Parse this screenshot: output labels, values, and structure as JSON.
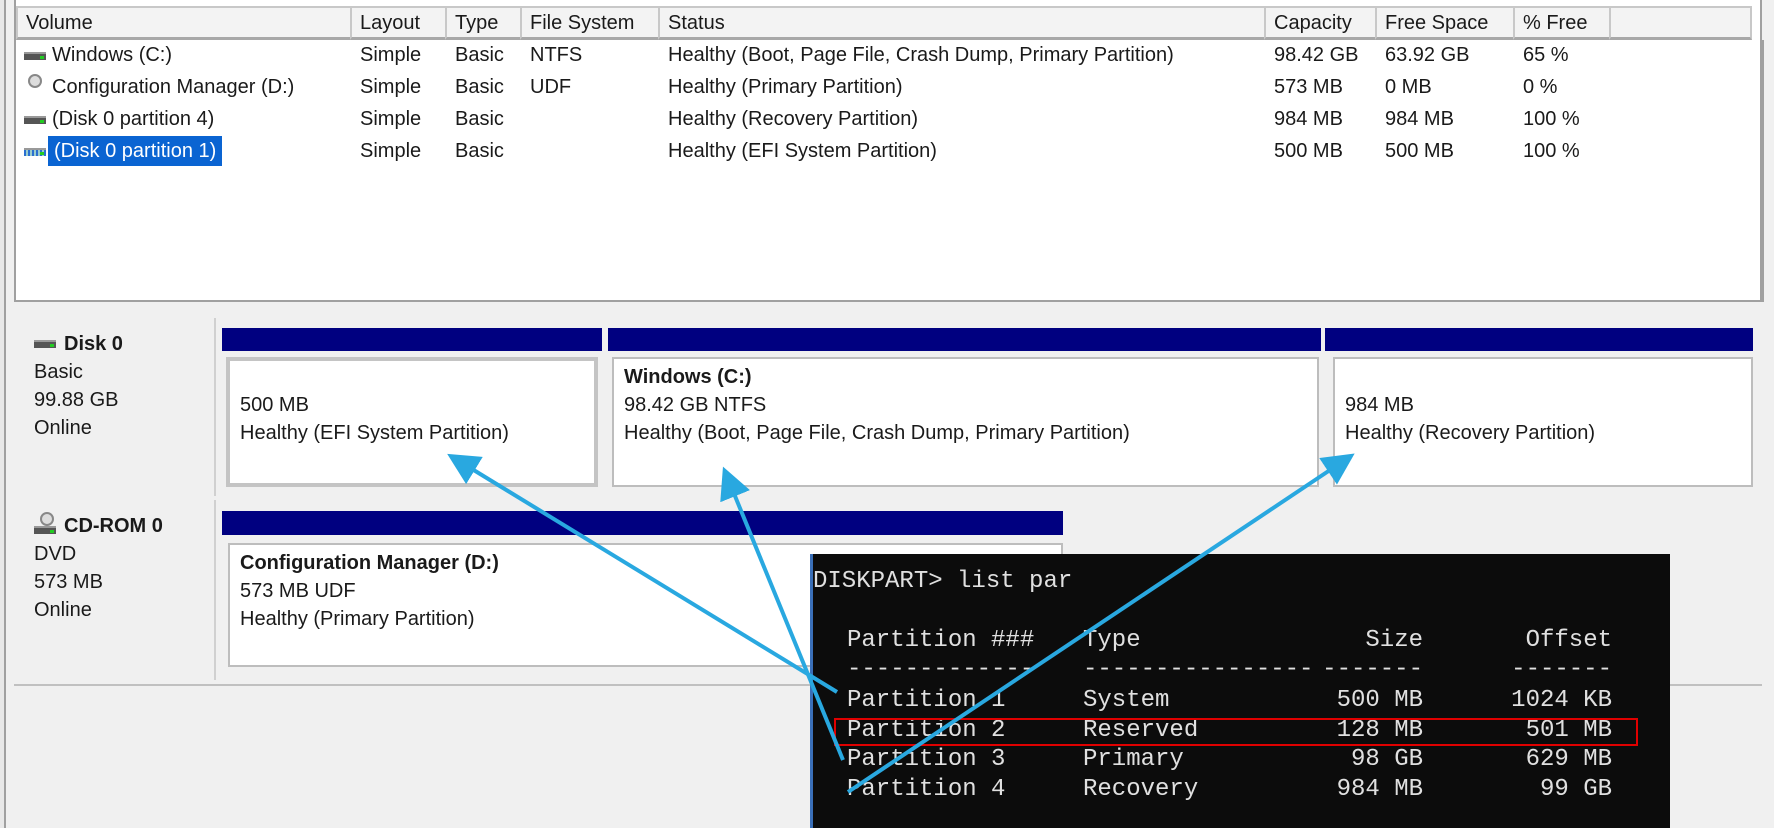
{
  "volume_list": {
    "columns": [
      "Volume",
      "Layout",
      "Type",
      "File System",
      "Status",
      "Capacity",
      "Free Space",
      "% Free"
    ],
    "rows": [
      {
        "icon": "hard-drive-icon",
        "volume": "Windows (C:)",
        "layout": "Simple",
        "type": "Basic",
        "fs": "NTFS",
        "status": "Healthy (Boot, Page File, Crash Dump, Primary Partition)",
        "capacity": "98.42 GB",
        "free": "63.92 GB",
        "pct": "65 %"
      },
      {
        "icon": "cd-drive-icon",
        "volume": "Configuration Manager (D:)",
        "layout": "Simple",
        "type": "Basic",
        "fs": "UDF",
        "status": "Healthy (Primary Partition)",
        "capacity": "573 MB",
        "free": "0 MB",
        "pct": "0 %"
      },
      {
        "icon": "hard-drive-icon",
        "volume": "(Disk 0 partition 4)",
        "layout": "Simple",
        "type": "Basic",
        "fs": "",
        "status": "Healthy (Recovery Partition)",
        "capacity": "984 MB",
        "free": "984 MB",
        "pct": "100 %"
      },
      {
        "icon": "striped-drive-icon",
        "volume": "(Disk 0 partition 1)",
        "layout": "Simple",
        "type": "Basic",
        "fs": "",
        "status": "Healthy (EFI System Partition)",
        "capacity": "500 MB",
        "free": "500 MB",
        "pct": "100 %",
        "selected": true
      }
    ]
  },
  "disks": [
    {
      "name": "Disk 0",
      "type": "Basic",
      "size": "99.88 GB",
      "state": "Online",
      "partitions": [
        {
          "title": "",
          "size": "500 MB",
          "status": "Healthy (EFI System Partition)"
        },
        {
          "title": "Windows  (C:)",
          "size": "98.42 GB NTFS",
          "status": "Healthy (Boot, Page File, Crash Dump, Primary Partition)"
        },
        {
          "title": "",
          "size": "984 MB",
          "status": "Healthy (Recovery Partition)"
        }
      ]
    },
    {
      "name": "CD-ROM 0",
      "type": "DVD",
      "size": "573 MB",
      "state": "Online",
      "partitions": [
        {
          "title": "Configuration Manager  (D:)",
          "size": "573 MB UDF",
          "status": "Healthy (Primary Partition)"
        }
      ]
    }
  ],
  "terminal": {
    "command": "DISKPART> list par",
    "headers": [
      "Partition ###",
      "Type",
      "Size",
      "Offset"
    ],
    "dashes": [
      "-------------",
      "----------------",
      "-------",
      "-------"
    ],
    "rows": [
      [
        "Partition 1",
        "System",
        "500 MB",
        "1024 KB"
      ],
      [
        "Partition 2",
        "Reserved",
        "128 MB",
        "501 MB"
      ],
      [
        "Partition 3",
        "Primary",
        "98 GB",
        "629 MB"
      ],
      [
        "Partition 4",
        "Recovery",
        "984 MB",
        "99 GB"
      ]
    ],
    "highlight_row": "Partition 2"
  },
  "colors": {
    "partition_bar": "#000080",
    "selection": "#0a64d2",
    "arrow": "#29a8e0",
    "highlight": "#e00000"
  }
}
